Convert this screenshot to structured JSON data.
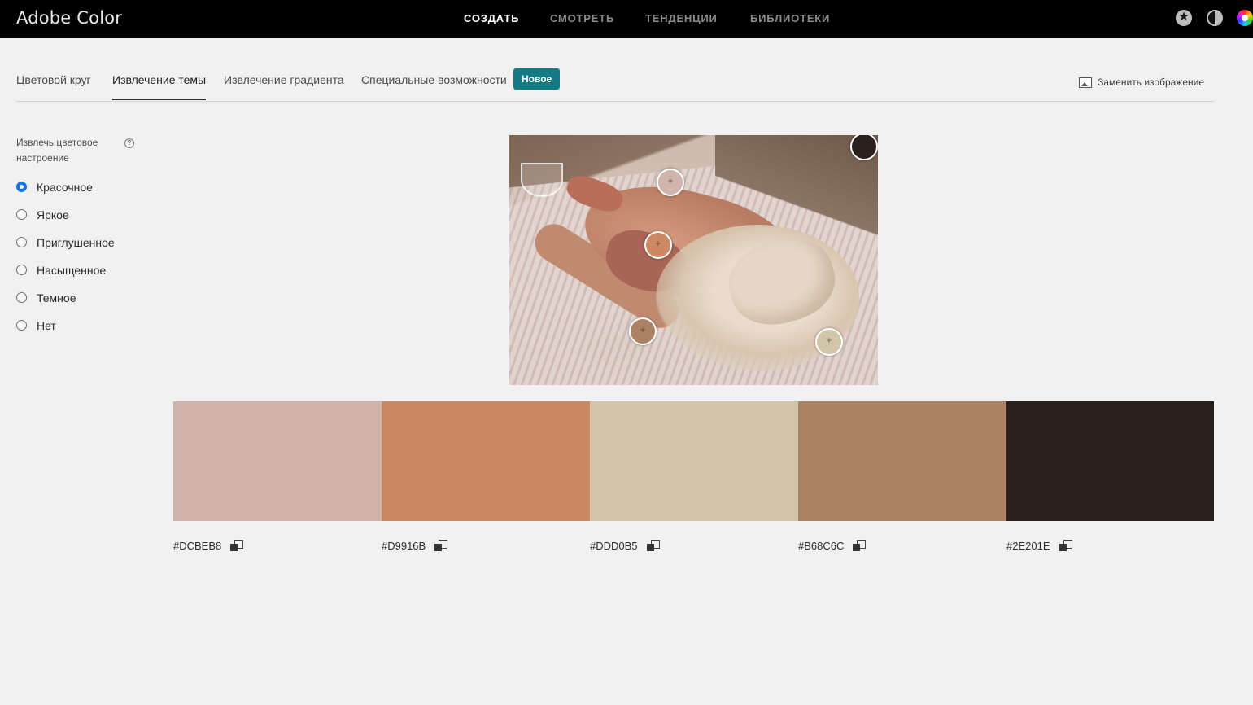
{
  "app": {
    "title": "Adobe Color"
  },
  "nav": {
    "items": [
      {
        "label": "СОЗДАТЬ",
        "active": true
      },
      {
        "label": "СМОТРЕТЬ",
        "active": false
      },
      {
        "label": "ТЕНДЕНЦИИ",
        "active": false
      },
      {
        "label": "БИБЛИОТЕКИ",
        "active": false
      }
    ],
    "icons": [
      "star-icon",
      "contrast-icon",
      "color-wheel-icon"
    ]
  },
  "tabs": {
    "items": [
      {
        "label": "Цветовой круг",
        "active": false
      },
      {
        "label": "Извлечение темы",
        "active": true
      },
      {
        "label": "Извлечение градиента",
        "active": false
      },
      {
        "label": "Специальные возможности",
        "active": false
      }
    ],
    "badge": "Новое",
    "replace_image": "Заменить изображение"
  },
  "sidebar": {
    "mood_title": "Извлечь цветовое настроение",
    "help_glyph": "?",
    "options": [
      {
        "label": "Красочное",
        "checked": true
      },
      {
        "label": "Яркое",
        "checked": false
      },
      {
        "label": "Приглушенное",
        "checked": false
      },
      {
        "label": "Насыщенное",
        "checked": false
      },
      {
        "label": "Темное",
        "checked": false
      },
      {
        "label": "Нет",
        "checked": false
      }
    ]
  },
  "palette": {
    "swatches": [
      {
        "hex": "#DCBEB8",
        "color": "#d0b4ac"
      },
      {
        "hex": "#D9916B",
        "color": "#cd8964"
      },
      {
        "hex": "#DDD0B5",
        "color": "#d1c5aa"
      },
      {
        "hex": "#B68C6C",
        "color": "#ab8263"
      },
      {
        "hex": "#2E201E",
        "color": "#2b1f1c"
      }
    ]
  },
  "colors": {
    "accent": "#1473e6",
    "badge": "#137b83",
    "topbar": "#000000"
  }
}
